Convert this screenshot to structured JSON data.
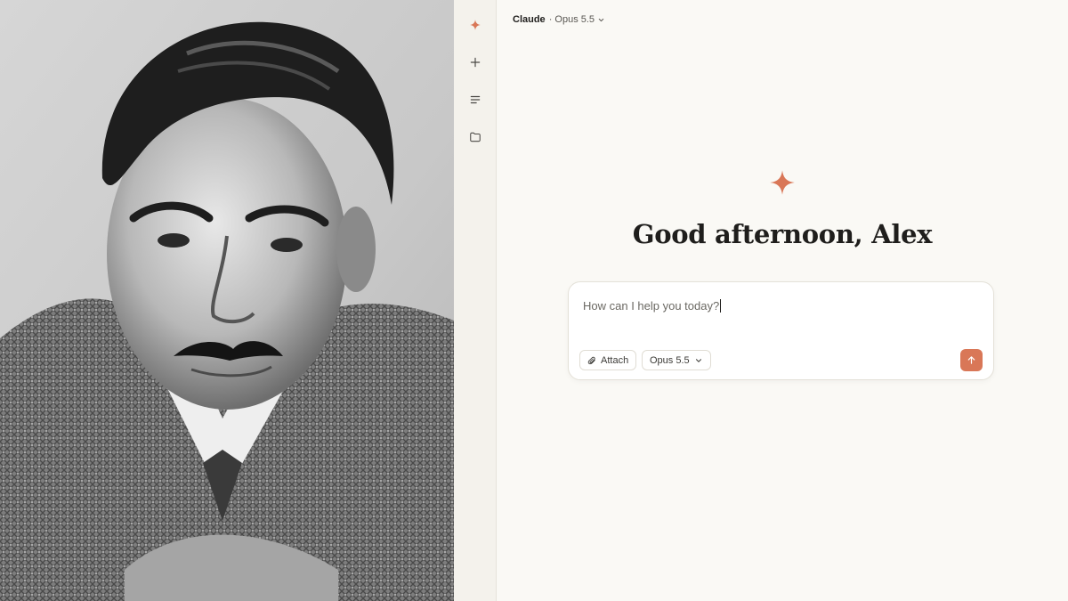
{
  "photo": {
    "icon": "portrait-photo"
  },
  "rail": {
    "items": [
      {
        "icon": "claude-logo-icon",
        "color": "#d97757"
      },
      {
        "icon": "plus-icon"
      },
      {
        "icon": "list-icon"
      },
      {
        "icon": "folder-icon"
      }
    ]
  },
  "topbar": {
    "brand": "Claude",
    "model_label": "· Opus 5.5",
    "icon": "chevron-down-icon"
  },
  "hero": {
    "icon": "claude-logo-icon",
    "greeting": "Good afternoon, Alex"
  },
  "composer": {
    "placeholder": "How can I help you today?",
    "attach_label": "Attach",
    "attach_icon": "paperclip-icon",
    "model_label": "Opus 5.5",
    "model_icon": "chevron-down-icon",
    "send_icon": "arrow-up-icon"
  },
  "colors": {
    "accent": "#d97757",
    "background": "#faf9f5",
    "rail_background": "#f4f2ec",
    "text": "#1f1e1c"
  }
}
